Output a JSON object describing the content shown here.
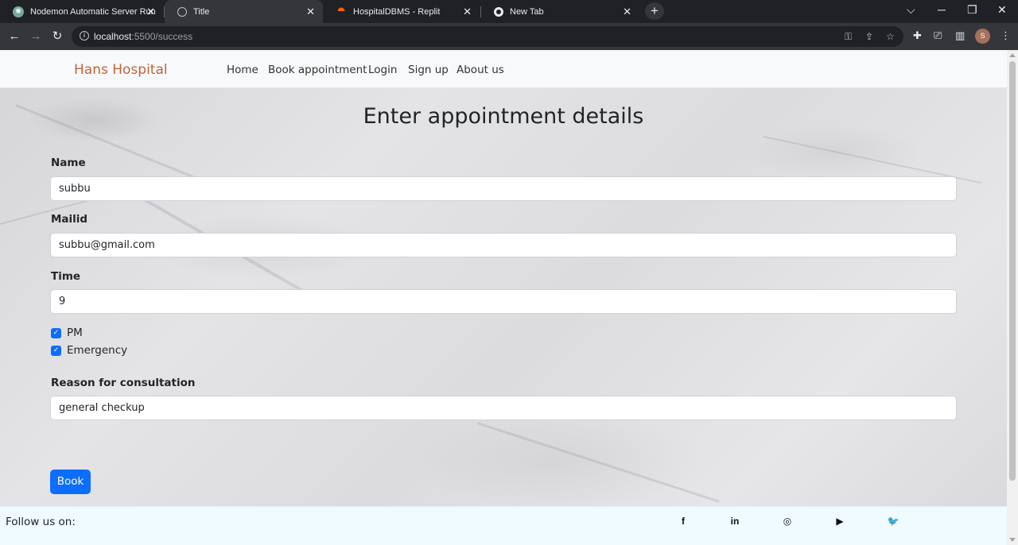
{
  "browser": {
    "tabs": [
      {
        "label": "Nodemon Automatic Server Run",
        "icon": "chatgpt-icon",
        "active": false
      },
      {
        "label": "Title",
        "icon": "globe-icon",
        "active": true
      },
      {
        "label": "HospitalDBMS - Replit",
        "icon": "replit-icon",
        "active": false
      },
      {
        "label": "New Tab",
        "icon": "chrome-icon",
        "active": false
      }
    ],
    "new_tab_symbol": "+",
    "close_symbol": "✕",
    "url_host": "localhost",
    "url_rest": ":5500/success",
    "profile_initial": "S"
  },
  "navbar": {
    "brand": "Hans Hospital",
    "links": [
      "Home",
      "Book appointment",
      "Login",
      "Sign up",
      "About us"
    ],
    "brand_color": "#c0643d"
  },
  "form": {
    "heading": "Enter appointment details",
    "name_label": "Name",
    "name_value": "subbu",
    "mail_label": "Mailid",
    "mail_value": "subbu@gmail.com",
    "time_label": "Time",
    "time_value": "9",
    "pm_label": "PM",
    "pm_checked": true,
    "emergency_label": "Emergency",
    "emergency_checked": true,
    "reason_label": "Reason for consultation",
    "reason_value": "general checkup",
    "submit_label": "Book",
    "accent_color": "#0d6efd"
  },
  "footer": {
    "follow_label": "Follow us on:",
    "social_icons": [
      "facebook-icon",
      "linkedin-icon",
      "instagram-icon",
      "youtube-icon",
      "twitter-icon"
    ]
  }
}
